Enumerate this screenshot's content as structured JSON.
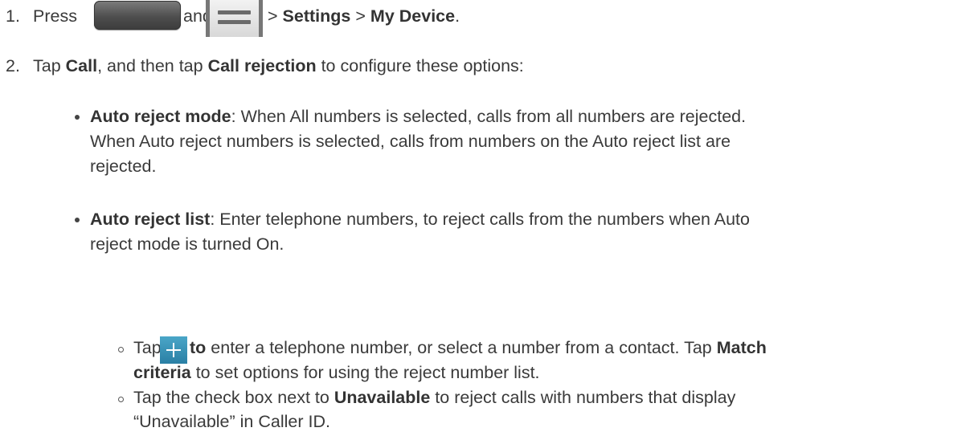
{
  "steps": [
    {
      "number": "1.",
      "press": "Press",
      "and_tap": "and tap",
      "sep1": ">",
      "settings": "Settings",
      "sep2": ">",
      "my_device": "My Device",
      "end": "."
    },
    {
      "number": "2.",
      "tap": "Tap",
      "call": "Call",
      "then_tap": ", and then tap",
      "call_rejection": "Call rejection",
      "rest": "to configure these options:"
    }
  ],
  "options": [
    {
      "title": "Auto reject mode",
      "lines": [
        ": When All numbers is selected, calls from all numbers are rejected.",
        "When Auto reject numbers is selected, calls from numbers on the Auto reject list are",
        "rejected."
      ]
    },
    {
      "title": "Auto reject list",
      "lines": [
        ": Enter telephone numbers, to reject calls from the numbers when Auto",
        "reject mode is turned On."
      ],
      "sub": [
        {
          "tap": "Tap",
          "to": "to",
          "text": "enter a telephone number, or select a number from a contact. Tap",
          "match": "Match",
          "criteria": "criteria",
          "line2": "to set options for using the reject number list."
        },
        {
          "text": "Tap the check box next to",
          "unavailable": "Unavailable",
          "rest": "to reject calls with numbers that display",
          "line2": "“Unavailable” in Caller ID."
        }
      ]
    }
  ],
  "icons": [
    "home-key-icon",
    "menu-key-icon",
    "plus-icon"
  ]
}
